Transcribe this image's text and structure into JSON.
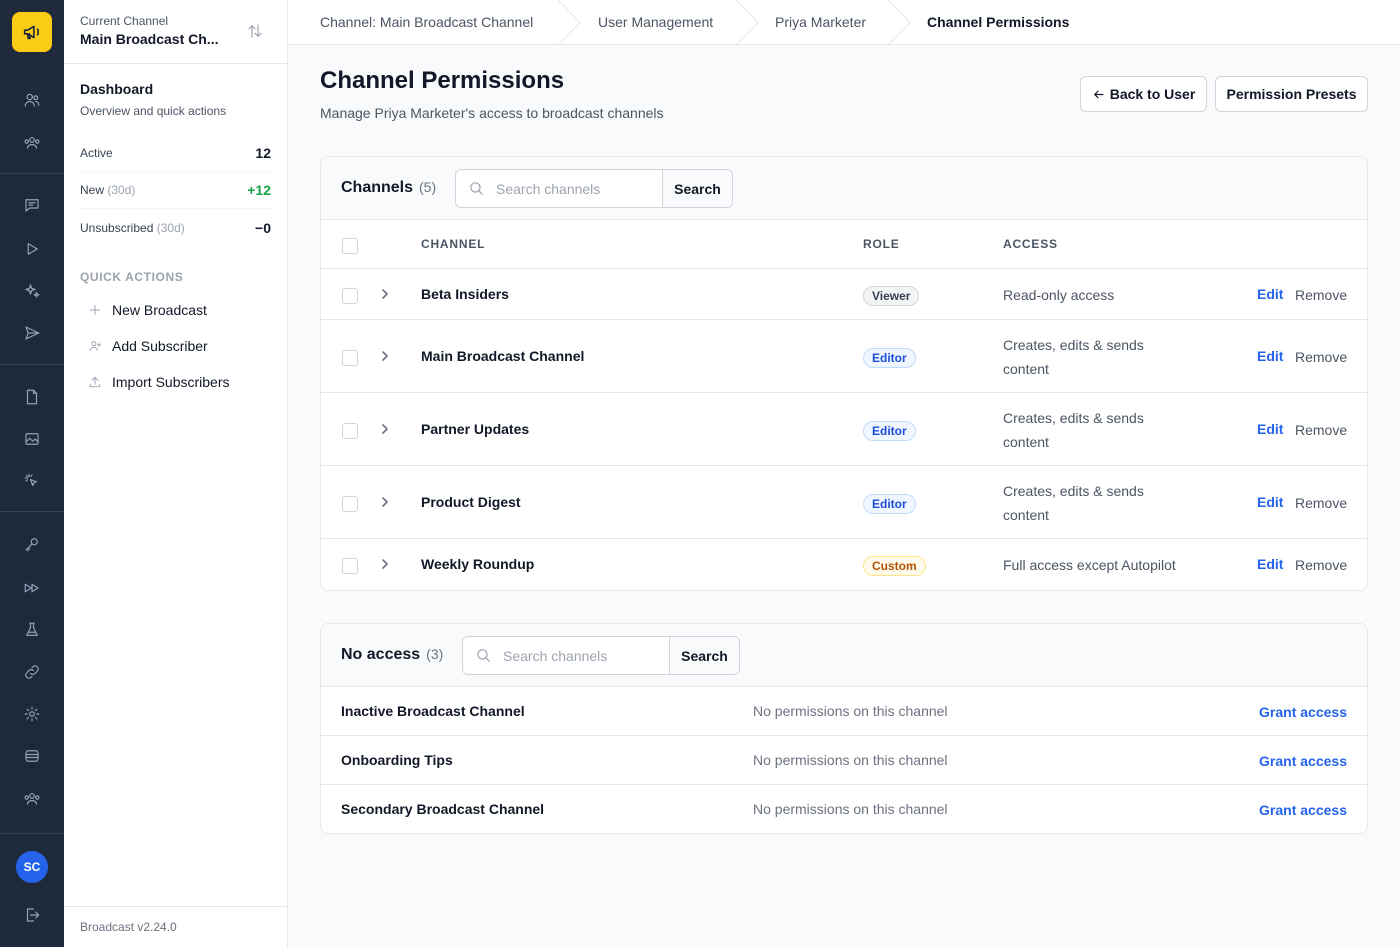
{
  "app": {
    "logo_icon": "megaphone-icon",
    "version": "Broadcast v2.24.0",
    "user_initials": "SC",
    "accent": "#facc15",
    "link_color": "#2563eb"
  },
  "rail": {
    "icons": [
      "users-icon",
      "team-icon",
      "messages-icon",
      "play-icon",
      "sparkles-icon",
      "send-icon",
      "document-icon",
      "image-icon",
      "cursor-click-icon",
      "key-icon",
      "fast-forward-icon",
      "flask-icon",
      "link-icon",
      "gear-icon",
      "database-icon",
      "group-icon",
      "logout-icon"
    ]
  },
  "sidebar": {
    "current_channel_label": "Current Channel",
    "current_channel_name": "Main Broadcast Ch...",
    "dashboard_title": "Dashboard",
    "dashboard_subtitle": "Overview and quick actions",
    "stats": [
      {
        "label": "Active",
        "suffix": "",
        "value": "12"
      },
      {
        "label": "New",
        "suffix": "(30d)",
        "value": "+12"
      },
      {
        "label": "Unsubscribed",
        "suffix": "(30d)",
        "value": "−0"
      }
    ],
    "quick_actions_title": "QUICK ACTIONS",
    "quick_actions": [
      {
        "label": "New Broadcast",
        "icon": "plus-icon"
      },
      {
        "label": "Add Subscriber",
        "icon": "user-plus-icon"
      },
      {
        "label": "Import Subscribers",
        "icon": "upload-icon"
      }
    ]
  },
  "breadcrumb": [
    "Channel: Main Broadcast Channel",
    "User Management",
    "Priya Marketer",
    "Channel Permissions"
  ],
  "page": {
    "title": "Channel Permissions",
    "subtitle": "Manage Priya Marketer's access to broadcast channels",
    "back_button": "Back to User",
    "presets_button": "Permission Presets"
  },
  "channels": {
    "title": "Channels",
    "count": "(5)",
    "search_placeholder": "Search channels",
    "search_button": "Search",
    "columns": {
      "channel": "CHANNEL",
      "role": "ROLE",
      "access": "ACCESS"
    },
    "edit_label": "Edit",
    "remove_label": "Remove",
    "rows": [
      {
        "name": "Beta Insiders",
        "role": "Viewer",
        "access": "Read-only access"
      },
      {
        "name": "Main Broadcast Channel",
        "role": "Editor",
        "access": "Creates, edits & sends content"
      },
      {
        "name": "Partner Updates",
        "role": "Editor",
        "access": "Creates, edits & sends content"
      },
      {
        "name": "Product Digest",
        "role": "Editor",
        "access": "Creates, edits & sends content"
      },
      {
        "name": "Weekly Roundup",
        "role": "Custom",
        "access": "Full access except Autopilot"
      }
    ]
  },
  "no_access": {
    "title": "No access",
    "count": "(3)",
    "search_placeholder": "Search channels",
    "search_button": "Search",
    "note": "No permissions on this channel",
    "grant_label": "Grant access",
    "rows": [
      "Inactive Broadcast Channel",
      "Onboarding Tips",
      "Secondary Broadcast Channel"
    ]
  }
}
